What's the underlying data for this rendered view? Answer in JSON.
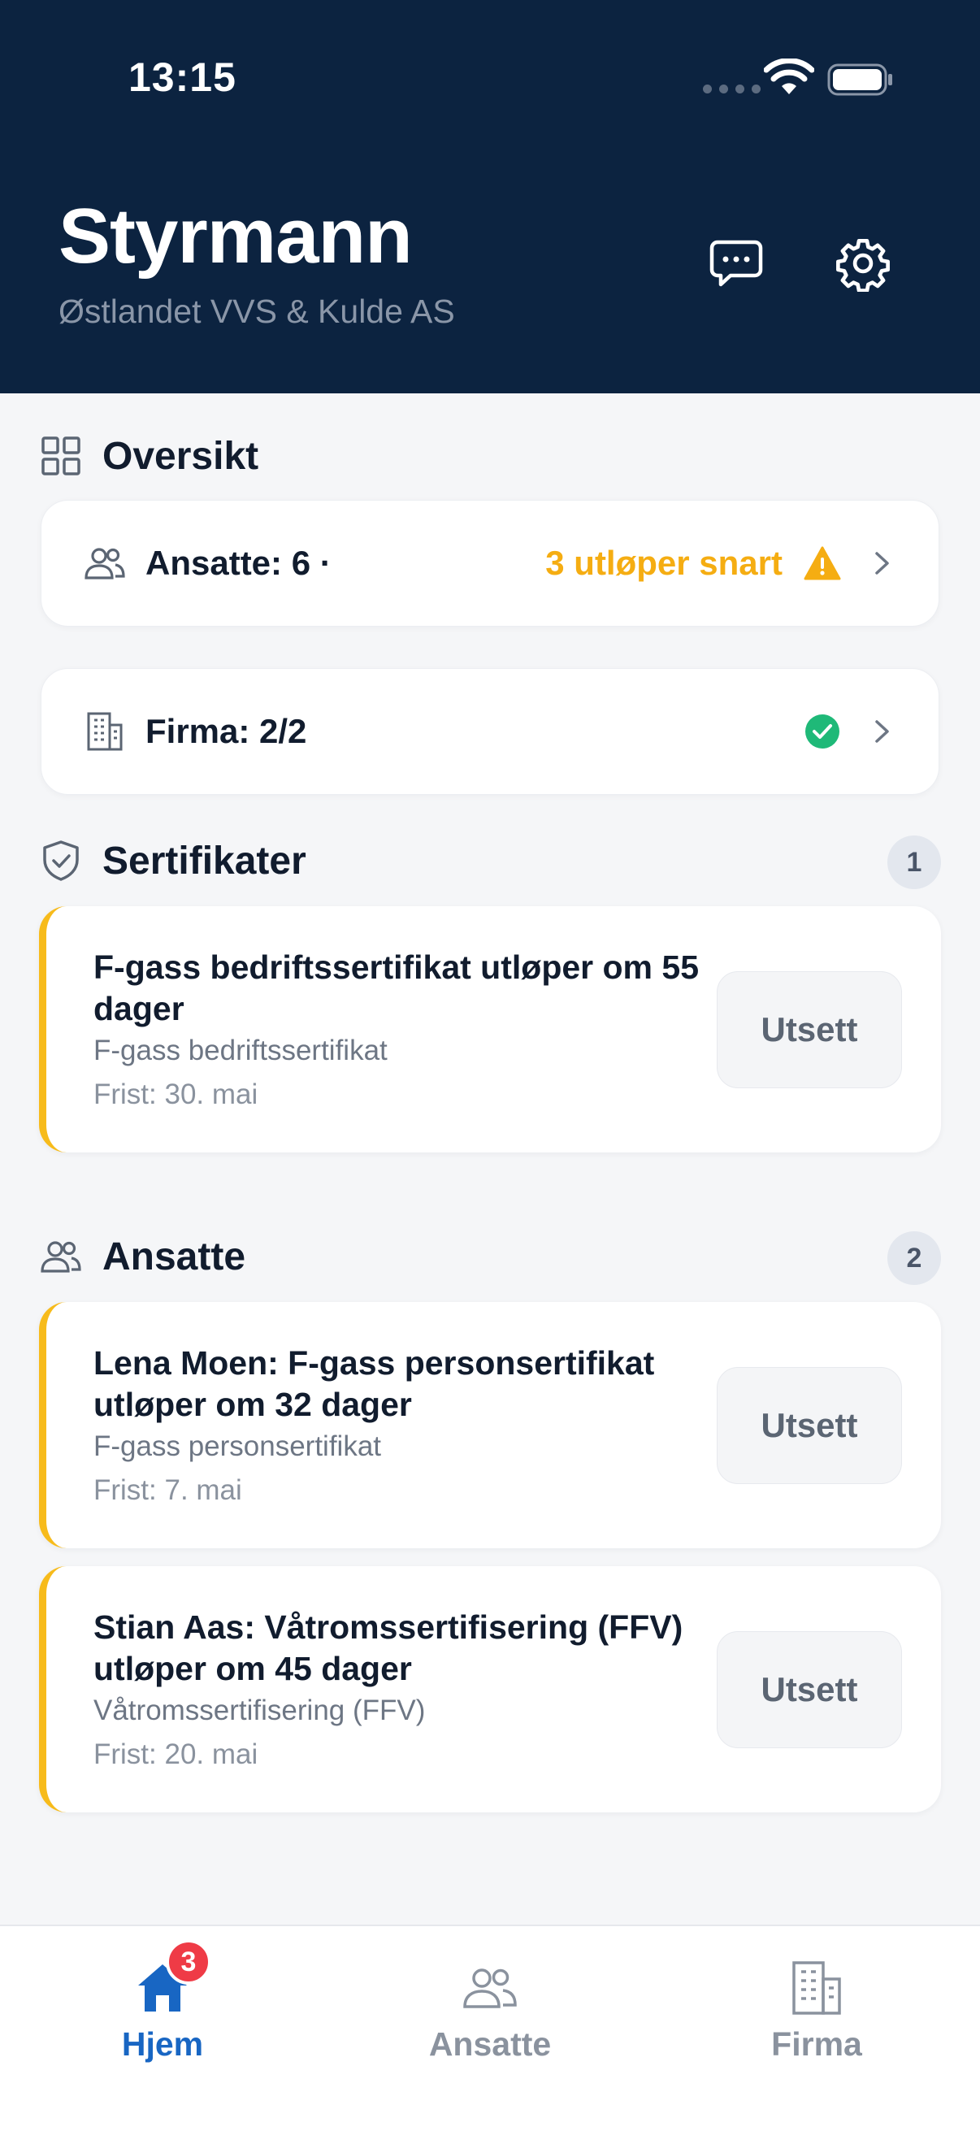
{
  "status_bar": {
    "time": "13:15"
  },
  "header": {
    "title": "Styrmann",
    "subtitle": "Østlandet VVS & Kulde AS",
    "chat_icon": "chat-bubble-icon",
    "settings_icon": "gear-icon"
  },
  "overview": {
    "heading": "Oversikt",
    "employees": {
      "label": "Ansatte: 6 ·",
      "warning": "3 utløper snart",
      "status": "warning"
    },
    "company": {
      "label": "Firma: 2/2",
      "status": "ok"
    }
  },
  "certificates": {
    "heading": "Sertifikater",
    "count": "1",
    "items": [
      {
        "title": "F-gass bedriftssertifikat utløper om 55 dager",
        "subtitle": "F-gass bedriftssertifikat",
        "due": "Frist: 30. mai",
        "action": "Utsett"
      }
    ]
  },
  "employees": {
    "heading": "Ansatte",
    "count": "2",
    "items": [
      {
        "title": "Lena Moen: F-gass personsertifikat utløper om 32 dager",
        "subtitle": "F-gass personsertifikat",
        "due": "Frist: 7. mai",
        "action": "Utsett"
      },
      {
        "title": "Stian Aas: Våtromssertifisering (FFV) utløper om 45 dager",
        "subtitle": "Våtromssertifisering (FFV)",
        "due": "Frist: 20. mai",
        "action": "Utsett"
      }
    ]
  },
  "tabbar": {
    "tabs": [
      {
        "label": "Hjem",
        "icon": "home-icon",
        "active": true,
        "badge": "3"
      },
      {
        "label": "Ansatte",
        "icon": "people-icon",
        "active": false
      },
      {
        "label": "Firma",
        "icon": "building-icon",
        "active": false
      }
    ]
  },
  "colors": {
    "header_bg": "#0c2340",
    "accent_blue": "#1866c3",
    "warning_yellow": "#f5ad12",
    "success_green": "#1fb978",
    "badge_red": "#ef3b46"
  }
}
